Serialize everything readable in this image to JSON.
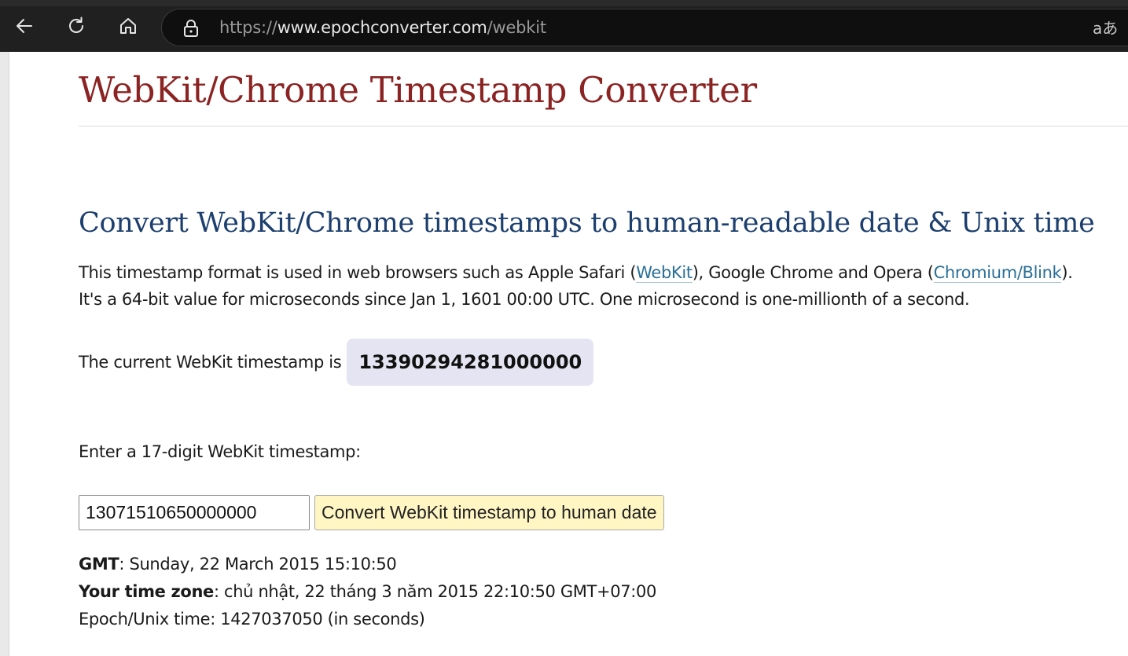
{
  "browser": {
    "url_scheme": "https://",
    "url_host": "www.epochconverter.com",
    "url_path": "/webkit",
    "translate_icon_text": "aあ"
  },
  "site": {
    "title": "WebKit/Chrome Timestamp Converter"
  },
  "main": {
    "heading": "Convert WebKit/Chrome timestamps to human-readable date & Unix time",
    "intro": {
      "part1": "This timestamp format is used in web browsers such as Apple Safari (",
      "link_webkit": "WebKit",
      "part2": "), Google Chrome and Opera (",
      "link_chromium": "Chromium/Blink",
      "part3": ").",
      "line2": "It's a 64-bit value for microseconds since Jan 1, 1601 00:00 UTC. One microsecond is one-millionth of a second."
    },
    "current_label": "The current WebKit timestamp is",
    "current_value": "13390294281000000",
    "enter_label": "Enter a 17-digit WebKit timestamp:",
    "input_value": "13071510650000000",
    "convert_button": "Convert WebKit timestamp to human date",
    "results": {
      "gmt_label": "GMT",
      "gmt_value": ": Sunday, 22 March 2015 15:10:50",
      "tz_label": "Your time zone",
      "tz_value": ": chủ nhật, 22 tháng 3 năm 2015 22:10:50 GMT+07:00",
      "epoch_text": "Epoch/Unix time: 1427037050 (in seconds)"
    }
  },
  "colors": {
    "title": "#8b2323",
    "heading": "#1c3f6e",
    "link": "#2a6f97",
    "current_value_bg": "#e4e4f2",
    "button_bg": "#fff6c4"
  },
  "icons": [
    "back-arrow-icon",
    "reload-icon",
    "home-icon",
    "lock-icon",
    "translate-icon"
  ]
}
